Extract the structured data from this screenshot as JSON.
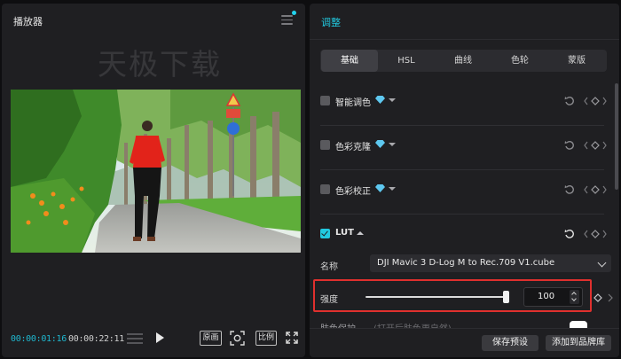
{
  "player": {
    "title": "播放器",
    "watermark": "天极下载",
    "timecode_current": "00:00:01:16",
    "timecode_total": "00:00:22:11",
    "btn_original": "原画",
    "btn_ratio": "比例"
  },
  "adjust": {
    "title": "调整",
    "tabs": [
      {
        "label": "基础",
        "active": true
      },
      {
        "label": "HSL",
        "active": false
      },
      {
        "label": "曲线",
        "active": false
      },
      {
        "label": "色轮",
        "active": false
      },
      {
        "label": "蒙版",
        "active": false
      }
    ],
    "sections": [
      {
        "label": "智能调色",
        "checked": false,
        "premium": true,
        "expanded": false
      },
      {
        "label": "色彩克隆",
        "checked": false,
        "premium": true,
        "expanded": false
      },
      {
        "label": "色彩校正",
        "checked": false,
        "premium": true,
        "expanded": false
      },
      {
        "label": "LUT",
        "checked": true,
        "premium": false,
        "expanded": true
      }
    ],
    "lut": {
      "name_label": "名称",
      "name_value": "DJI Mavic 3 D-Log M to Rec.709 V1.cube",
      "strength_label": "强度",
      "strength_value": "100",
      "strength_fraction": 1.0
    },
    "hidden_row_label": "肤色保护",
    "hidden_row_hint": "(打开后肤色更自然)",
    "save_preset": "保存预设",
    "add_brand": "添加到品牌库"
  },
  "colors": {
    "accent": "#22c9e0",
    "timecode": "#1fb8d0",
    "highlight_box": "#e0302e",
    "panel_bg": "#1f1f22"
  },
  "icons": [
    "menu-icon",
    "play-icon",
    "snapshot-icon",
    "fullscreen-icon",
    "reset-icon",
    "keyframe-icon",
    "gem-icon",
    "chevron-down-icon"
  ]
}
